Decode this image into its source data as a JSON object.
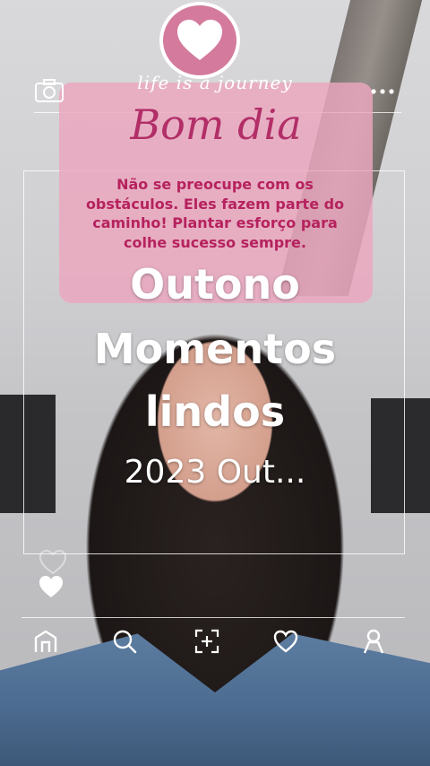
{
  "overlay": {
    "top_caption": "life is a journey",
    "greeting": "Bom dia",
    "message": "Não se preocupe com os obstáculos. Eles fazem parte do caminho! Plantar esforço para colhe sucesso sempre.",
    "headline_1": "Outono",
    "headline_2": "Momentos",
    "headline_3": "lindos",
    "headline_4": "2023 Out..."
  },
  "icons": {
    "top_left": "camera-icon",
    "top_right": "more-icon",
    "badge": "heart-icon",
    "side": "heart-icon",
    "nav": [
      "home-icon",
      "search-icon",
      "add-icon",
      "heart-icon",
      "profile-icon"
    ]
  },
  "colors": {
    "card_pink": "#eca6be",
    "badge_pink": "#d47a9c",
    "greeting": "#b22e67",
    "message": "#b6225e",
    "white": "#ffffff"
  }
}
